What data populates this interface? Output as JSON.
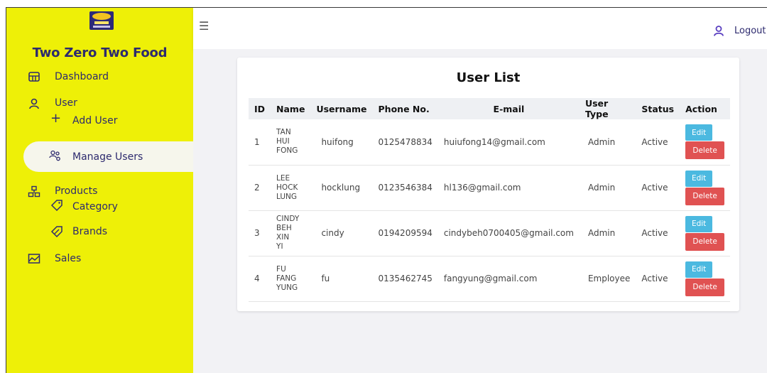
{
  "sidebar": {
    "brand": "Two Zero Two Food",
    "items": {
      "dashboard": "Dashboard",
      "user": "User",
      "add_user": "Add User",
      "manage_users": "Manage Users",
      "products": "Products",
      "category": "Category",
      "brands": "Brands",
      "sales": "Sales"
    },
    "active": "manage_users",
    "background": "#eef007"
  },
  "header": {
    "menu_icon": "hamburger-icon",
    "logout_label": "Logout"
  },
  "card": {
    "title": "User List"
  },
  "table": {
    "columns": [
      "ID",
      "Name",
      "Username",
      "Phone No.",
      "E-mail",
      "User Type",
      "Status",
      "Action"
    ],
    "edit_label": "Edit",
    "delete_label": "Delete",
    "rows": [
      {
        "id": "1",
        "name_lines": [
          "TAN",
          "HUI",
          "FONG"
        ],
        "username": "huifong",
        "phone": "0125478834",
        "email": "huiufong14@gmail.com",
        "user_type": "Admin",
        "status": "Active"
      },
      {
        "id": "2",
        "name_lines": [
          "LEE",
          "HOCK",
          "LUNG"
        ],
        "username": "hocklung",
        "phone": "0123546384",
        "email": "hl136@gmail.com",
        "user_type": "Admin",
        "status": "Active"
      },
      {
        "id": "3",
        "name_lines": [
          "CINDY",
          "BEH XIN",
          "YI"
        ],
        "username": "cindy",
        "phone": "0194209594",
        "email": "cindybeh0700405@gmail.com",
        "user_type": "Admin",
        "status": "Active"
      },
      {
        "id": "4",
        "name_lines": [
          "FU",
          "FANG",
          "YUNG"
        ],
        "username": "fu",
        "phone": "0135462745",
        "email": "fangyung@gmail.com",
        "user_type": "Employee",
        "status": "Active"
      }
    ]
  },
  "colors": {
    "accent": "#2d2a6e",
    "edit": "#4bb9e0",
    "delete": "#e05252"
  }
}
